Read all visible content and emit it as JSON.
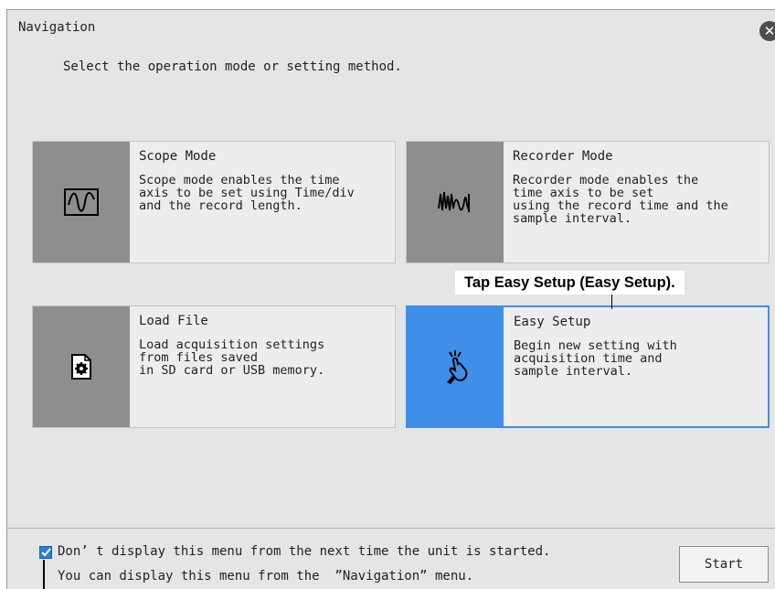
{
  "window": {
    "title": "Navigation",
    "close_icon": "close-icon",
    "subtitle": "Select the operation mode or setting method."
  },
  "cards": [
    {
      "icon": "sine-wave-icon",
      "title": "Scope Mode",
      "description": "Scope mode enables the time\naxis to be set using Time/div\nand the record length."
    },
    {
      "icon": "waveform-record-icon",
      "title": "Recorder Mode",
      "description": "Recorder mode enables the\ntime axis to be set\nusing the record time and the\nsample interval."
    },
    {
      "icon": "file-settings-icon",
      "title": "Load File",
      "description": "Load acquisition settings\nfrom files saved\nin SD card or USB memory."
    },
    {
      "icon": "tap-hand-icon",
      "title": "Easy Setup",
      "description": "Begin new setting with\nacquisition time and\nsample interval.",
      "selected": true
    }
  ],
  "callout": "Tap Easy Setup (Easy Setup).",
  "footer": {
    "checkbox_checked": true,
    "checkbox_label": "Don’ t display this menu from the next time the unit is started.",
    "hint": "You can display this menu from the  ”Navigation” menu.",
    "start_label": "Start"
  },
  "colors": {
    "accent": "#3f8fe8",
    "icon_panel": "#8e8e8e",
    "background": "#e5e5e5"
  }
}
